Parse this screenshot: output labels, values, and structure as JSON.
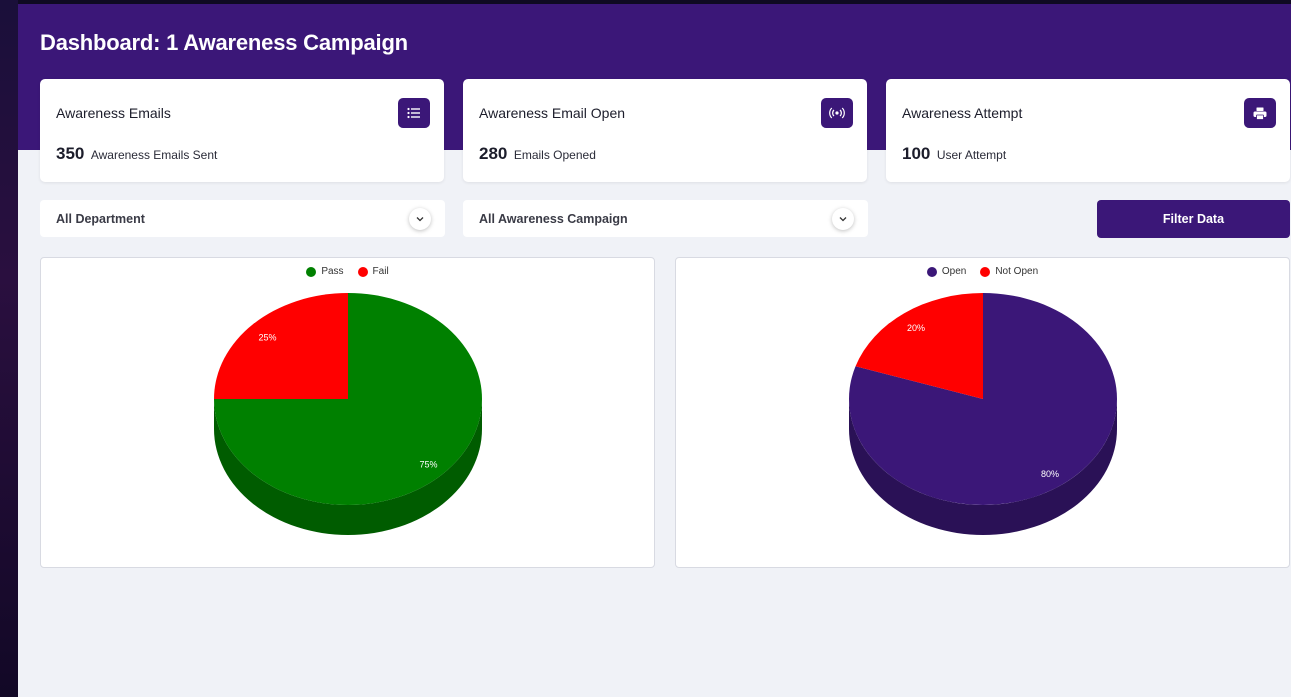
{
  "page": {
    "title": "Dashboard: 1 Awareness Campaign"
  },
  "colors": {
    "brand": "#3b1778",
    "pass": "#008000",
    "fail": "#ff0000",
    "open": "#3b1778",
    "not_open": "#ff0000"
  },
  "cards": [
    {
      "title": "Awareness Emails",
      "value": "350",
      "label": "Awareness Emails Sent",
      "icon": "list-icon"
    },
    {
      "title": "Awareness Email Open",
      "value": "280",
      "label": "Emails Opened",
      "icon": "broadcast-icon"
    },
    {
      "title": "Awareness Attempt",
      "value": "100",
      "label": "User Attempt",
      "icon": "printer-icon"
    }
  ],
  "filters": {
    "department": "All Department",
    "campaign": "All Awareness Campaign",
    "button_label": "Filter Data"
  },
  "chart_data": [
    {
      "type": "pie",
      "categories": [
        "Pass",
        "Fail"
      ],
      "values": [
        75,
        25
      ],
      "value_labels": [
        "75%",
        "25%"
      ],
      "colors": [
        "#008000",
        "#ff0000"
      ],
      "legend": "top-center"
    },
    {
      "type": "pie",
      "categories": [
        "Open",
        "Not Open"
      ],
      "values": [
        80,
        20
      ],
      "value_labels": [
        "80%",
        "20%"
      ],
      "colors": [
        "#3b1778",
        "#ff0000"
      ],
      "legend": "top-center"
    }
  ]
}
